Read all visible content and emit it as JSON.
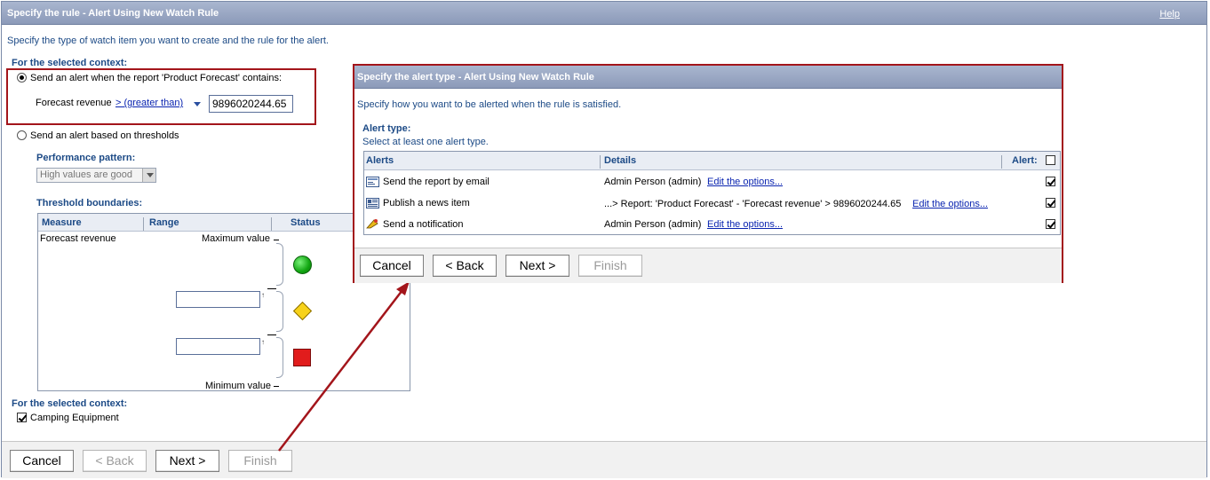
{
  "window": {
    "title": "Specify the rule - Alert Using New Watch Rule",
    "help": "Help"
  },
  "intro": "Specify the type of watch item you want to create and the rule for the alert.",
  "context_heading": "For the selected context:",
  "option_report": {
    "label": "Send an alert when the report 'Product Forecast' contains:",
    "measure": "Forecast revenue",
    "operator": "> (greater than)",
    "value": "9896020244.65"
  },
  "option_thresholds": {
    "label": "Send an alert based on thresholds"
  },
  "performance": {
    "heading": "Performance pattern:",
    "selected": "High values are good"
  },
  "threshold": {
    "heading": "Threshold boundaries:",
    "col_measure": "Measure",
    "col_range": "Range",
    "col_status": "Status",
    "measure": "Forecast revenue",
    "max_label": "Maximum value",
    "min_label": "Minimum value",
    "upper_value": "",
    "lower_value": ""
  },
  "context2": {
    "heading": "For the selected context:",
    "item": "Camping Equipment"
  },
  "footer": {
    "cancel": "Cancel",
    "back": "< Back",
    "next": "Next >",
    "finish": "Finish"
  },
  "alert_dialog": {
    "title": "Specify the alert type - Alert Using New Watch Rule",
    "intro": "Specify how you want to be alerted when the rule is satisfied.",
    "heading": "Alert type:",
    "subheading": "Select at least one alert type.",
    "col_alerts": "Alerts",
    "col_details": "Details",
    "col_alert": "Alert:",
    "rows": [
      {
        "name": "Send the report by email",
        "details": "Admin Person (admin)",
        "link": "Edit the options...",
        "icon": "email-icon"
      },
      {
        "name": "Publish a news item",
        "details": "...> Report: 'Product Forecast' - 'Forecast revenue' > 9896020244.65",
        "link": "Edit the options...",
        "icon": "news-icon"
      },
      {
        "name": "Send a notification",
        "details": "Admin Person (admin)",
        "link": "Edit the options...",
        "icon": "notification-icon"
      }
    ],
    "footer": {
      "cancel": "Cancel",
      "back": "< Back",
      "next": "Next >",
      "finish": "Finish"
    }
  },
  "colors": {
    "titlebar": "#8c9ab9",
    "heading": "#1c4a86",
    "highlight": "#a3151b",
    "link": "#0a24b0"
  }
}
